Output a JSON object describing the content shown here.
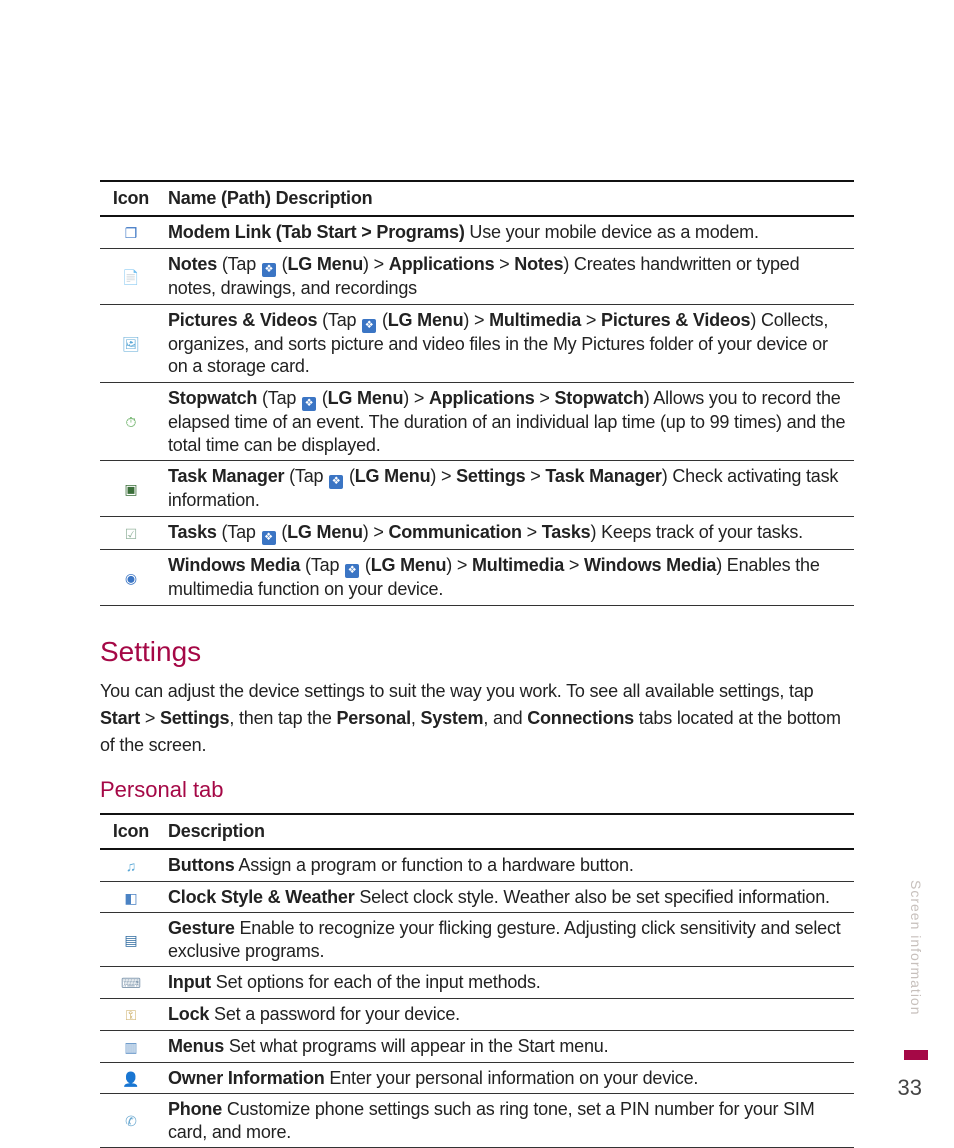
{
  "sideLabel": "Screen information",
  "pageNumber": "33",
  "table1": {
    "head1": "Icon",
    "head2": "Name (Path) Description",
    "rows": [
      {
        "icon": "modem-link-icon",
        "glyph": "❐",
        "color": "#3b75c4",
        "pieces": [
          {
            "b": "Modem Link (Tab Start > Programs) "
          },
          "Use your mobile device as a modem."
        ]
      },
      {
        "icon": "notes-icon",
        "glyph": "📄",
        "color": "#e7c56a",
        "pieces": [
          {
            "b": "Notes"
          },
          " (Tap ",
          {
            "ic": true
          },
          " (",
          {
            "b": "LG Menu"
          },
          ") > ",
          {
            "b": "Applications"
          },
          " > ",
          {
            "b": "Notes"
          },
          ") Creates handwritten or typed notes, drawings, and recordings"
        ]
      },
      {
        "icon": "pictures-videos-icon",
        "glyph": "🖼",
        "color": "#5aa7d6",
        "pieces": [
          {
            "b": "Pictures & Videos"
          },
          " (Tap ",
          {
            "ic": true
          },
          " (",
          {
            "b": "LG Menu"
          },
          ") > ",
          {
            "b": "Multimedia"
          },
          " > ",
          {
            "b": "Pictures & Videos"
          },
          ") Collects, organizes, and sorts picture and video files in the My Pictures folder of your device or on a storage card."
        ]
      },
      {
        "icon": "stopwatch-icon",
        "glyph": "⏱",
        "color": "#4fa24a",
        "pieces": [
          {
            "b": "Stopwatch"
          },
          " (Tap ",
          {
            "ic": true
          },
          " (",
          {
            "b": "LG Menu"
          },
          ") > ",
          {
            "b": "Applications"
          },
          " > ",
          {
            "b": "Stopwatch"
          },
          ") Allows you to record the elapsed time of an event. The duration of an individual lap time (up to 99 times) and the total time can be displayed."
        ]
      },
      {
        "icon": "task-manager-icon",
        "glyph": "▣",
        "color": "#3b6f3a",
        "pieces": [
          {
            "b": "Task Manager"
          },
          " (Tap ",
          {
            "ic": true
          },
          " (",
          {
            "b": "LG Menu"
          },
          ") > ",
          {
            "b": "Settings"
          },
          " > ",
          {
            "b": "Task Manager"
          },
          ") Check activating task information."
        ]
      },
      {
        "icon": "tasks-icon",
        "glyph": "☑",
        "color": "#98b7a2",
        "pieces": [
          {
            "b": "Tasks"
          },
          " (Tap ",
          {
            "ic": true
          },
          " (",
          {
            "b": "LG Menu"
          },
          ") > ",
          {
            "b": "Communication"
          },
          " > ",
          {
            "b": "Tasks"
          },
          ") Keeps track of your tasks."
        ]
      },
      {
        "icon": "windows-media-icon",
        "glyph": "◉",
        "color": "#3b75c4",
        "pieces": [
          {
            "b": "Windows Media"
          },
          " (Tap ",
          {
            "ic": true
          },
          " (",
          {
            "b": "LG Menu"
          },
          ") > ",
          {
            "b": "Multimedia"
          },
          " > ",
          {
            "b": "Windows Media"
          },
          ") Enables the multimedia function on your device."
        ]
      }
    ]
  },
  "settings": {
    "heading": "Settings",
    "para_pieces": [
      "You can adjust the device settings to suit the way you work. To see all available settings, tap ",
      {
        "b": "Start"
      },
      " > ",
      {
        "b": "Settings"
      },
      ", then tap the ",
      {
        "b": "Personal"
      },
      ", ",
      {
        "b": "System"
      },
      ", and ",
      {
        "b": "Connections"
      },
      " tabs located at the bottom of the screen."
    ],
    "subHeading": "Personal tab"
  },
  "table2": {
    "head1": "Icon",
    "head2": "Description",
    "rows": [
      {
        "icon": "buttons-icon",
        "glyph": "♫",
        "color": "#5aa7d6",
        "pieces": [
          {
            "b": "Buttons"
          },
          " Assign a program or function to a hardware button."
        ]
      },
      {
        "icon": "clock-weather-icon",
        "glyph": "◧",
        "color": "#4b83c4",
        "pieces": [
          {
            "b": "Clock Style & Weather"
          },
          " Select clock style. Weather also be set specified information."
        ]
      },
      {
        "icon": "gesture-icon",
        "glyph": "▤",
        "color": "#2f6a9f",
        "pieces": [
          {
            "b": "Gesture"
          },
          " Enable to recognize your flicking gesture. Adjusting click sensitivity and select exclusive programs."
        ]
      },
      {
        "icon": "input-icon",
        "glyph": "⌨",
        "color": "#8aa0b4",
        "pieces": [
          {
            "b": "Input"
          },
          " Set options for each of the input methods."
        ]
      },
      {
        "icon": "lock-icon",
        "glyph": "⚿",
        "color": "#c7a657",
        "pieces": [
          {
            "b": "Lock"
          },
          " Set a password for your device."
        ]
      },
      {
        "icon": "menus-icon",
        "glyph": "▥",
        "color": "#5a8ec4",
        "pieces": [
          {
            "b": "Menus"
          },
          " Set what programs will appear in the Start menu."
        ]
      },
      {
        "icon": "owner-info-icon",
        "glyph": "👤",
        "color": "#d18a3c",
        "pieces": [
          {
            "b": "Owner Information"
          },
          " Enter your personal information on your device."
        ]
      },
      {
        "icon": "phone-icon",
        "glyph": "✆",
        "color": "#6aa8d0",
        "pieces": [
          {
            "b": "Phone"
          },
          " Customize phone settings such as ring tone, set a PIN number for your SIM card, and more."
        ]
      }
    ]
  }
}
